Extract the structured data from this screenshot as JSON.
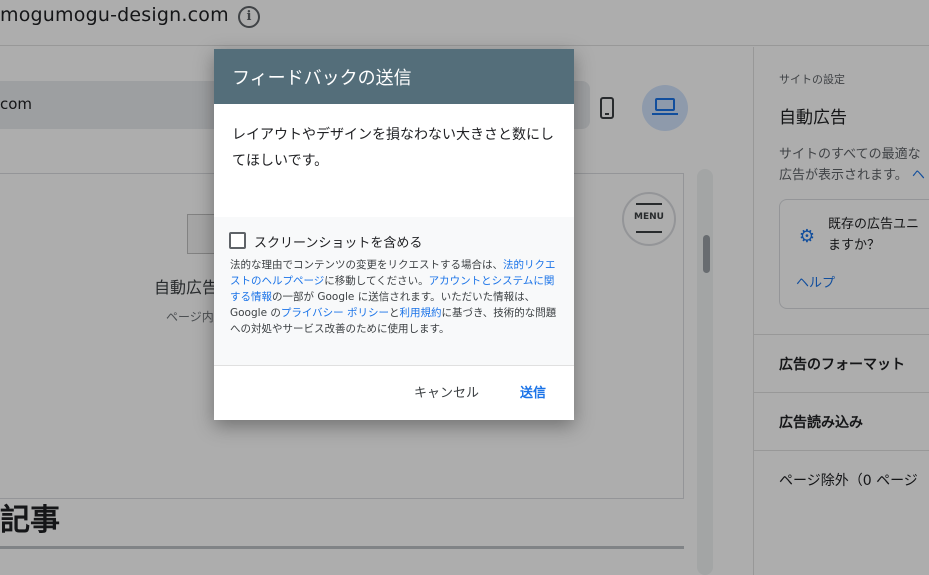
{
  "header": {
    "site_name": "ogumogu-design.com",
    "site_name_prefix": "m"
  },
  "preview": {
    "url_text": "com",
    "ad_title": "自動広告",
    "ad_subtitle": "ページ内",
    "menu_label": "MENU",
    "articles_heading": "記事"
  },
  "sidebar": {
    "breadcrumb": "サイトの設定",
    "title": "自動広告",
    "description_line1": "サイトのすべての最適な",
    "description_line2": "広告が表示されます。",
    "description_link": "ヘ",
    "card_text_line1": "既存の広告ユニ",
    "card_text_line2": "ますか？",
    "card_link": "ヘルプ",
    "rows": [
      {
        "label": "広告のフォーマット"
      },
      {
        "label": "広告読み込み"
      },
      {
        "label": "ページ除外（0 ページ"
      }
    ]
  },
  "dialog": {
    "title": "フィードバックの送信",
    "feedback_value": "レイアウトやデザインを損なわない大きさと数にしてほしいです。",
    "checkbox_label": "スクリーンショットを含める",
    "checkbox_checked": false,
    "legal": {
      "p1": "法的な理由でコンテンツの変更をリクエストする場合は、",
      "link1": "法的リクエストのヘルプページ",
      "p2": "に移動してください。",
      "link2": "アカウントとシステムに関する情報",
      "p3": "の一部が Google に送信されます。いただいた情報は、Google の",
      "link3": "プライバシー ポリシー",
      "p4": "と",
      "link4": "利用規約",
      "p5": "に基づき、技術的な問題への対処やサービス改善のために使用します。"
    },
    "cancel_label": "キャンセル",
    "send_label": "送信"
  },
  "colors": {
    "dialog_header": "#546e7a",
    "link": "#1a73e8",
    "scrim": "rgba(0,0,0,0.32)"
  }
}
